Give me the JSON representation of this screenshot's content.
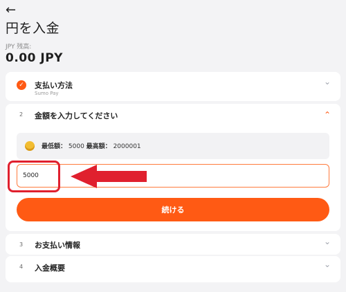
{
  "header": {
    "back_icon": "←",
    "title": "円を入金"
  },
  "balance": {
    "label": "JPY 残高:",
    "value": "0.00 JPY"
  },
  "steps": {
    "method": {
      "check_icon": "✓",
      "title": "支払い方法",
      "subtitle": "Sumo Pay"
    },
    "amount": {
      "number": "2",
      "title": "金額を入力してください",
      "limits": {
        "min_label": "最低額：",
        "min_value": "5000",
        "max_label": "最高額：",
        "max_value": "2000001"
      },
      "input_value": "5000",
      "continue_label": "続ける"
    },
    "info": {
      "number": "3",
      "title": "お支払い情報"
    },
    "summary": {
      "number": "4",
      "title": "入金概要"
    }
  },
  "icons": {
    "chevron_down": "⌄",
    "chevron_up": "⌃"
  },
  "colors": {
    "accent": "#ff5a14",
    "annotation_red": "#e0202e"
  }
}
